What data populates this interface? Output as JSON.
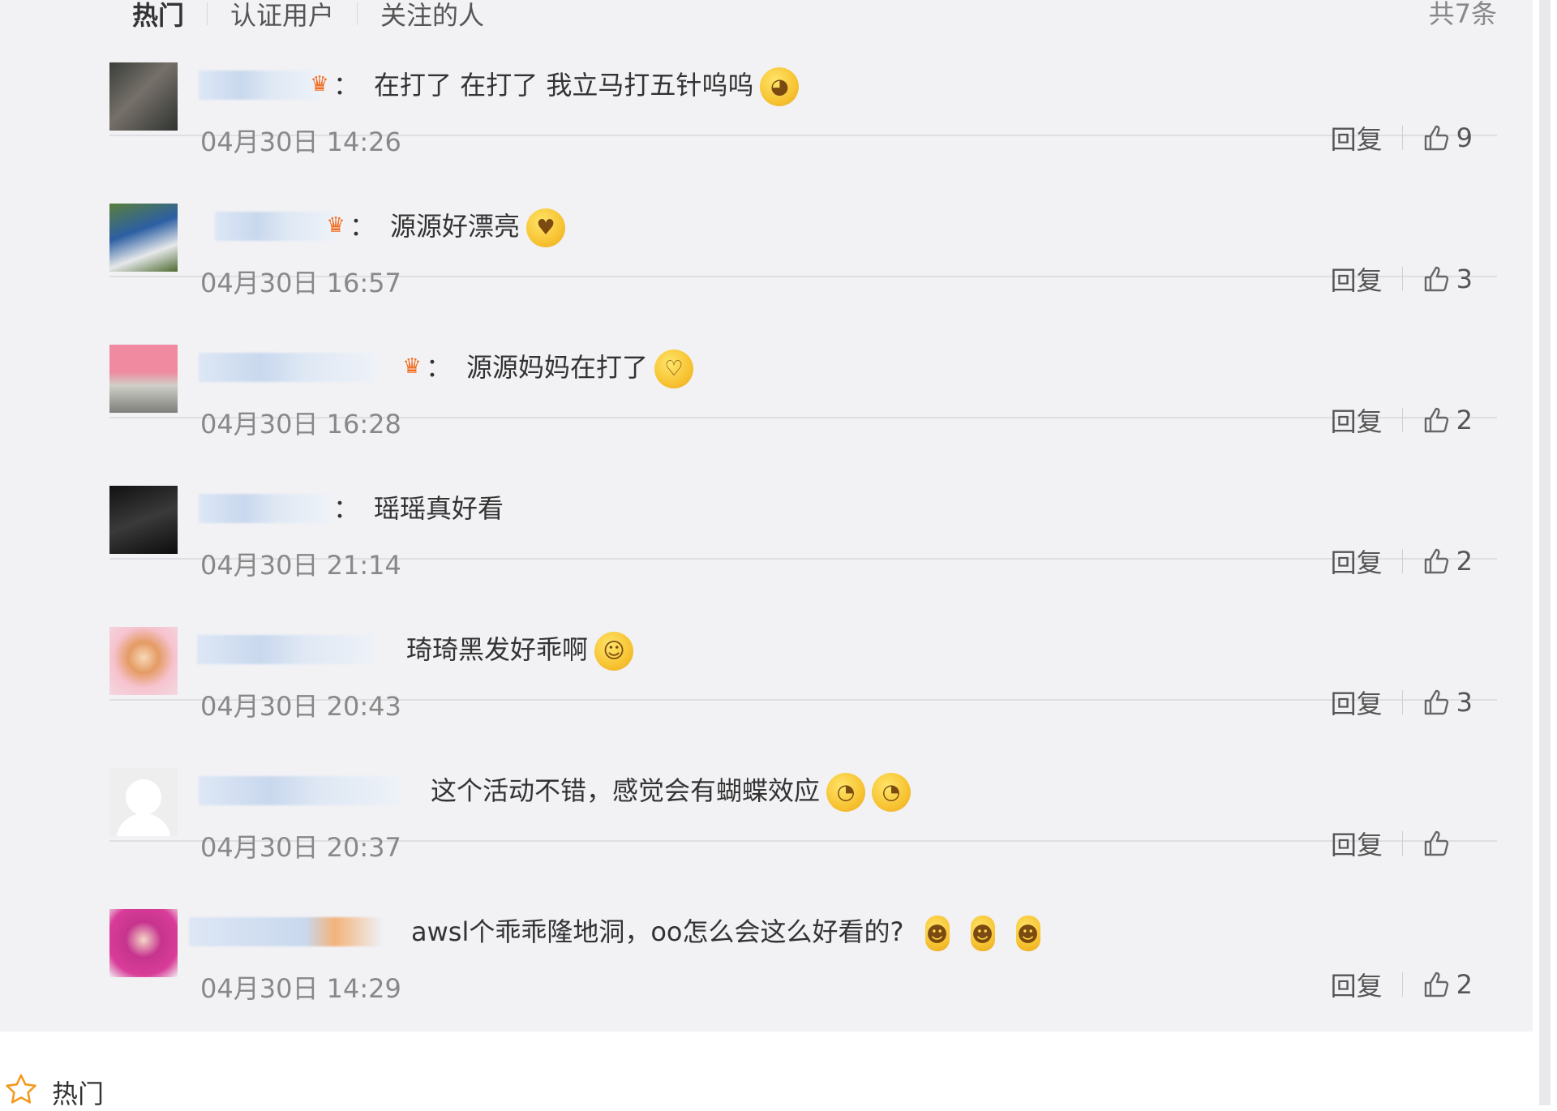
{
  "tabs": [
    {
      "label": "热门",
      "active": true
    },
    {
      "label": "认证用户",
      "active": false
    },
    {
      "label": "关注的人",
      "active": false
    }
  ],
  "total_count": "共7条",
  "comments": [
    {
      "text": "在打了 在打了 我立马打五针呜呜",
      "emoji": "crying-emoji",
      "time": "04月30日 14:26",
      "likes": "9",
      "has_crown": true
    },
    {
      "text": "源源好漂亮",
      "emoji": "heart-eyes-emoji",
      "time": "04月30日 16:57",
      "likes": "3",
      "has_crown": true
    },
    {
      "text": "源源妈妈在打了",
      "emoji": "kiss-emoji",
      "time": "04月30日 16:28",
      "likes": "2",
      "has_crown": true
    },
    {
      "text": "瑶瑶真好看",
      "emoji": "",
      "time": "04月30日 21:14",
      "likes": "2",
      "has_crown": false
    },
    {
      "text": "琦琦黑发好乖啊",
      "emoji": "happy-emoji",
      "time": "04月30日 20:43",
      "likes": "3",
      "has_crown": false
    },
    {
      "text": "这个活动不错，感觉会有蝴蝶效应",
      "emoji": "doge-emoji",
      "time": "04月30日 20:37",
      "likes": "",
      "has_crown": false
    },
    {
      "text": "awsl个乖乖隆地洞，oo怎么会这么好看的?",
      "emoji": "shy-doll-emoji",
      "time": "04月30日 14:29",
      "likes": "2",
      "has_crown": false
    }
  ],
  "reply_label": "回复",
  "colon": "：",
  "bottom_tab": {
    "label": "热门",
    "icon": "star-icon"
  }
}
